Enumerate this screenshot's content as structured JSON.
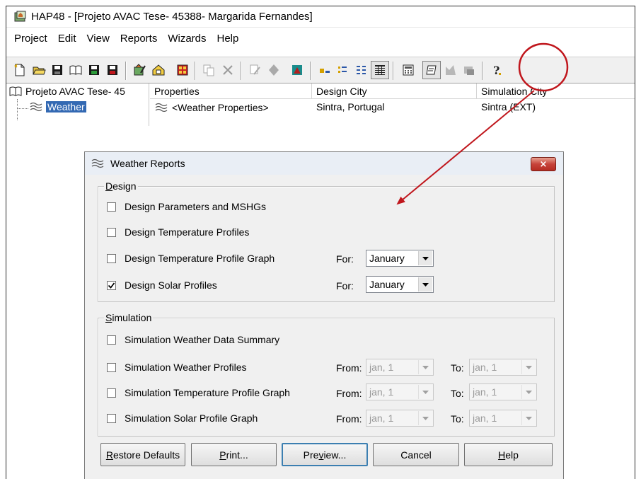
{
  "window": {
    "title": "HAP48 - [Projeto AVAC Tese- 45388- Margarida Fernandes]"
  },
  "menu": [
    "Project",
    "Edit",
    "View",
    "Reports",
    "Wizards",
    "Help"
  ],
  "toolbar": {
    "buttons": [
      "new-project-icon",
      "open-project-icon",
      "save-icon",
      "project-library-icon",
      "archive-icon",
      "save-as-icon",
      "edit-item-icon",
      "home-icon",
      "building-icon",
      "copy-icon",
      "delete-icon",
      "properties-icon",
      "locate-icon",
      "system-design-icon",
      "large-icons-icon",
      "small-icons-icon",
      "list-view-icon",
      "details-view-icon",
      "calculator-icon",
      "print-report-icon",
      "preview-icon",
      "view-report-icon",
      "help-icon"
    ]
  },
  "tree": {
    "root_label": "Projeto AVAC Tese- 45",
    "weather_label": "Weather"
  },
  "list": {
    "headers": [
      "Properties",
      "Design City",
      "Simulation City"
    ],
    "row": {
      "properties": "<Weather Properties>",
      "design_city": "Sintra, Portugal",
      "simulation_city": "Sintra (EXT)"
    }
  },
  "dialog": {
    "title": "Weather Reports",
    "close_label": "×",
    "design": {
      "legend_accel": "D",
      "legend_rest": "esign",
      "items": [
        {
          "label": "Design Parameters and MSHGs",
          "checked": false
        },
        {
          "label": "Design Temperature Profiles",
          "checked": false
        },
        {
          "label": "Design Temperature Profile Graph",
          "checked": false,
          "for_label": "For:",
          "month": "January"
        },
        {
          "label": "Design Solar Profiles",
          "checked": true,
          "for_label": "For:",
          "month": "January"
        }
      ]
    },
    "simulation": {
      "legend_accel": "S",
      "legend_rest": "imulation",
      "items": [
        {
          "label": "Simulation Weather Data Summary",
          "checked": false
        },
        {
          "label": "Simulation Weather Profiles",
          "checked": false,
          "from_label": "From:",
          "from": "jan, 1",
          "to_label": "To:",
          "to": "jan, 1"
        },
        {
          "label": "Simulation Temperature Profile Graph",
          "checked": false,
          "from_label": "From:",
          "from": "jan, 1",
          "to_label": "To:",
          "to": "jan, 1"
        },
        {
          "label": "Simulation Solar Profile Graph",
          "checked": false,
          "from_label": "From:",
          "from": "jan, 1",
          "to_label": "To:",
          "to": "jan, 1"
        }
      ]
    },
    "buttons": {
      "restore_accel": "R",
      "restore_rest": "estore Defaults",
      "print_accel": "P",
      "print_rest": "rint...",
      "preview_pre": "Pre",
      "preview_accel": "v",
      "preview_rest": "iew...",
      "cancel": "Cancel",
      "help_accel": "H",
      "help_rest": "elp"
    }
  },
  "colors": {
    "annotation": "#c0161c",
    "selection": "#3369b3",
    "dialog_bg": "#f0f0f0"
  }
}
